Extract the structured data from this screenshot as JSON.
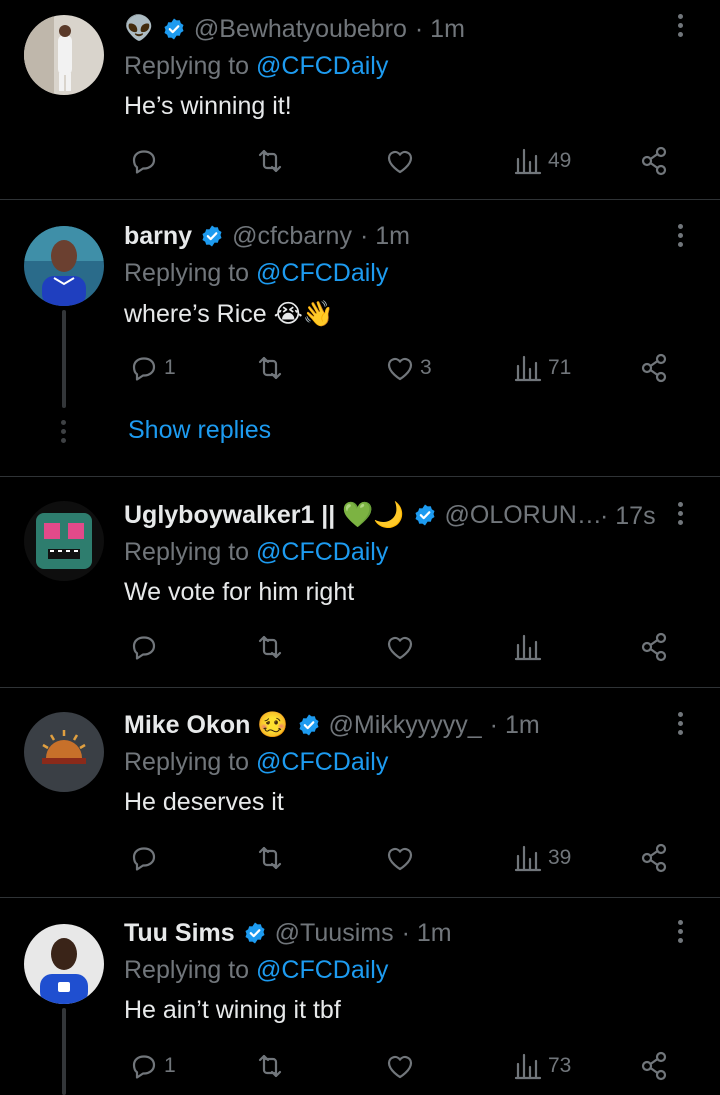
{
  "tweets": [
    {
      "name": "",
      "emoji": "👽",
      "handle": "@Bewhatyoubebro",
      "time": "· 1m",
      "replying_prefix": "Replying to",
      "replying_to": "@CFCDaily",
      "text": "He’s winning it!",
      "replies": "",
      "likes": "",
      "views": "49"
    },
    {
      "name": "barny",
      "handle": "@cfcbarny",
      "time": "· 1m",
      "replying_prefix": "Replying to",
      "replying_to": "@CFCDaily",
      "text": "where’s Rice 😭👋",
      "replies": "1",
      "likes": "3",
      "views": "71",
      "show_replies": "Show replies"
    },
    {
      "name": "Uglyboywalker1 || 💚🌙",
      "handle": "@OLORUNF...",
      "time": "· 17s",
      "replying_prefix": "Replying to",
      "replying_to": "@CFCDaily",
      "text": "We vote for him right",
      "replies": "",
      "likes": "",
      "views": ""
    },
    {
      "name": "Mike Okon 🥴",
      "handle": "@Mikkyyyyy_",
      "time": "· 1m",
      "replying_prefix": "Replying to",
      "replying_to": "@CFCDaily",
      "text": "He deserves it",
      "replies": "",
      "likes": "",
      "views": "39"
    },
    {
      "name": "Tuu Sims",
      "handle": "@Tuusims",
      "time": "· 1m",
      "replying_prefix": "Replying to",
      "replying_to": "@CFCDaily",
      "text": "He ain’t wining it tbf",
      "replies": "1",
      "likes": "",
      "views": "73"
    }
  ],
  "colors": {
    "background": "#000000",
    "text": "#e7e9ea",
    "muted": "#71767b",
    "accent": "#1d9bf0",
    "divider": "#2f3336"
  },
  "icons": [
    "reply-icon",
    "retweet-icon",
    "like-icon",
    "views-icon",
    "share-icon",
    "more-icon",
    "verified-badge-icon"
  ]
}
